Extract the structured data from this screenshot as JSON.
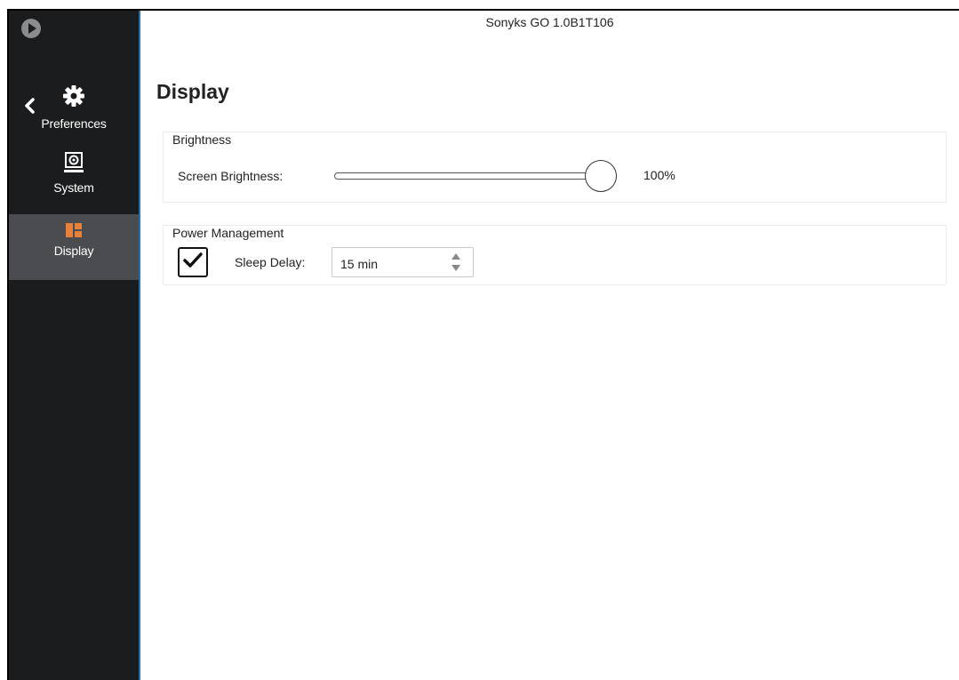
{
  "window": {
    "title": "Sonyks GO 1.0B1T106"
  },
  "sidebar": {
    "items": [
      {
        "label": "Preferences",
        "icon": "gear-icon"
      },
      {
        "label": "System",
        "icon": "system-icon"
      },
      {
        "label": "Display",
        "icon": "display-icon",
        "selected": true
      }
    ]
  },
  "page": {
    "title": "Display",
    "brightness": {
      "group_title": "Brightness",
      "label": "Screen Brightness:",
      "value_text": "100%",
      "value_percent": 100
    },
    "power": {
      "group_title": "Power Management",
      "sleep_enabled": true,
      "sleep_label": "Sleep Delay:",
      "sleep_value": "15 min"
    }
  },
  "colors": {
    "sidebar_bg": "#1a1c1e",
    "sidebar_selected": "#4a4c4f",
    "display_icon": "#e8823a",
    "accent_edge": "#2a6fa8"
  }
}
